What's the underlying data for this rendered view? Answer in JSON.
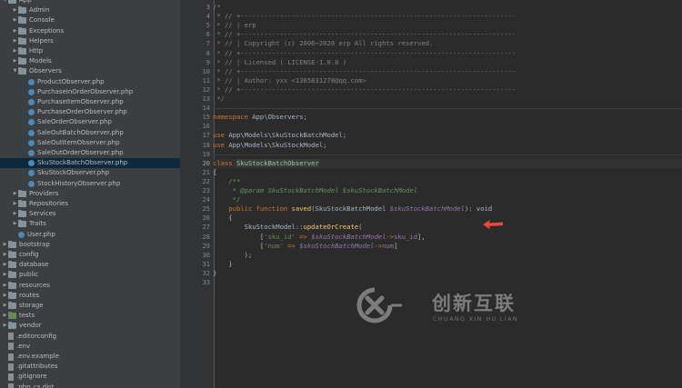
{
  "sidebar": {
    "items": [
      {
        "label": "App",
        "type": "folder",
        "depth": 0,
        "expanded": true
      },
      {
        "label": "Admin",
        "type": "folder",
        "depth": 1,
        "expanded": false
      },
      {
        "label": "Console",
        "type": "folder",
        "depth": 1,
        "expanded": false
      },
      {
        "label": "Exceptions",
        "type": "folder",
        "depth": 1,
        "expanded": false
      },
      {
        "label": "Helpers",
        "type": "folder",
        "depth": 1,
        "expanded": false
      },
      {
        "label": "Http",
        "type": "folder",
        "depth": 1,
        "expanded": false
      },
      {
        "label": "Models",
        "type": "folder",
        "depth": 1,
        "expanded": false
      },
      {
        "label": "Observers",
        "type": "folder",
        "depth": 1,
        "expanded": true
      },
      {
        "label": "ProductObserver.php",
        "type": "php",
        "depth": 2
      },
      {
        "label": "PurchaseInOrderObserver.php",
        "type": "php",
        "depth": 2
      },
      {
        "label": "PurchaseItemObserver.php",
        "type": "php",
        "depth": 2
      },
      {
        "label": "PurchaseOrderObserver.php",
        "type": "php",
        "depth": 2
      },
      {
        "label": "SaleOrderObserver.php",
        "type": "php",
        "depth": 2
      },
      {
        "label": "SaleOutBatchObserver.php",
        "type": "php",
        "depth": 2
      },
      {
        "label": "SaleOutItemObserver.php",
        "type": "php",
        "depth": 2
      },
      {
        "label": "SaleOutOrderObserver.php",
        "type": "php",
        "depth": 2
      },
      {
        "label": "SkuStockBatchObserver.php",
        "type": "php",
        "depth": 2,
        "selected": true
      },
      {
        "label": "SkuStockObserver.php",
        "type": "php",
        "depth": 2
      },
      {
        "label": "StockHistoryObserver.php",
        "type": "php",
        "depth": 2
      },
      {
        "label": "Providers",
        "type": "folder",
        "depth": 1,
        "expanded": false
      },
      {
        "label": "Repositories",
        "type": "folder",
        "depth": 1,
        "expanded": false
      },
      {
        "label": "Services",
        "type": "folder",
        "depth": 1,
        "expanded": false
      },
      {
        "label": "Traits",
        "type": "folder",
        "depth": 1,
        "expanded": false
      },
      {
        "label": "User.php",
        "type": "php",
        "depth": 1
      },
      {
        "label": "bootstrap",
        "type": "folder",
        "depth": 0,
        "expanded": false
      },
      {
        "label": "config",
        "type": "folder",
        "depth": 0,
        "expanded": false
      },
      {
        "label": "database",
        "type": "folder",
        "depth": 0,
        "expanded": false
      },
      {
        "label": "public",
        "type": "folder",
        "depth": 0,
        "expanded": false
      },
      {
        "label": "resources",
        "type": "folder",
        "depth": 0,
        "expanded": false
      },
      {
        "label": "routes",
        "type": "folder",
        "depth": 0,
        "expanded": false
      },
      {
        "label": "storage",
        "type": "folder",
        "depth": 0,
        "expanded": false
      },
      {
        "label": "tests",
        "type": "folder-green",
        "depth": 0,
        "expanded": false
      },
      {
        "label": "vendor",
        "type": "folder",
        "depth": 0,
        "expanded": false
      },
      {
        "label": ".editorconfig",
        "type": "file",
        "depth": 0
      },
      {
        "label": ".env",
        "type": "file",
        "depth": 0
      },
      {
        "label": ".env.example",
        "type": "file",
        "depth": 0
      },
      {
        "label": ".gitattributes",
        "type": "file",
        "depth": 0
      },
      {
        "label": ".gitignore",
        "type": "file",
        "depth": 0
      },
      {
        "label": ".php_cs.dist",
        "type": "file",
        "depth": 0
      }
    ]
  },
  "editor": {
    "current_line": 20,
    "lines": [
      {
        "no": "3",
        "t": [
          [
            "cm",
            "/*"
          ]
        ]
      },
      {
        "no": "4",
        "t": [
          [
            "cm",
            " * // +----------------------------------------------------------------------"
          ]
        ]
      },
      {
        "no": "5",
        "t": [
          [
            "cm",
            " * // | erp"
          ]
        ]
      },
      {
        "no": "6",
        "t": [
          [
            "cm",
            " * // +----------------------------------------------------------------------"
          ]
        ]
      },
      {
        "no": "7",
        "t": [
          [
            "cm",
            " * // | Copyright (c) 2006~2020 erp All rights reserved."
          ]
        ]
      },
      {
        "no": "8",
        "t": [
          [
            "cm",
            " * // +----------------------------------------------------------------------"
          ]
        ]
      },
      {
        "no": "9",
        "t": [
          [
            "cm",
            " * // | Licensed ( LICENSE-1.0.0 )"
          ]
        ]
      },
      {
        "no": "10",
        "t": [
          [
            "cm",
            " * // +----------------------------------------------------------------------"
          ]
        ]
      },
      {
        "no": "11",
        "t": [
          [
            "cm",
            " * // | Author: yxx <1365831278@qq.com>"
          ]
        ]
      },
      {
        "no": "12",
        "t": [
          [
            "cm",
            " * // +----------------------------------------------------------------------"
          ]
        ]
      },
      {
        "no": "13",
        "t": [
          [
            "cm",
            " */"
          ]
        ]
      },
      {
        "no": "14",
        "t": []
      },
      {
        "no": "15",
        "t": [
          [
            "kw",
            "namespace "
          ],
          [
            "",
            "App\\Observers;"
          ]
        ]
      },
      {
        "no": "16",
        "t": []
      },
      {
        "no": "17",
        "t": [
          [
            "kw",
            "use "
          ],
          [
            "",
            "App\\Models\\SkuStockBatchModel;"
          ]
        ]
      },
      {
        "no": "18",
        "t": [
          [
            "kw",
            "use "
          ],
          [
            "",
            "App\\Models\\SkuStockModel;"
          ]
        ]
      },
      {
        "no": "19",
        "t": []
      },
      {
        "no": "20",
        "t": [
          [
            "kw",
            "class "
          ],
          [
            "hl",
            "SkuStockBatchObserver"
          ]
        ]
      },
      {
        "no": "21",
        "t": [
          [
            "",
            "{"
          ]
        ]
      },
      {
        "no": "22",
        "t": [
          [
            "doc",
            "    /**"
          ]
        ]
      },
      {
        "no": "23",
        "t": [
          [
            "doc",
            "     * @param SkuStockBatchModel $skuStockBatchModel"
          ]
        ]
      },
      {
        "no": "24",
        "t": [
          [
            "doc",
            "     */"
          ]
        ]
      },
      {
        "no": "25",
        "t": [
          [
            "kw",
            "    public function "
          ],
          [
            "fn",
            "saved"
          ],
          [
            "",
            "(SkuStockBatchModel "
          ],
          [
            "var",
            "$skuStockBatchModel"
          ],
          [
            "",
            "): void"
          ]
        ]
      },
      {
        "no": "26",
        "t": [
          [
            "",
            "    {"
          ]
        ]
      },
      {
        "no": "27",
        "t": [
          [
            "",
            "        SkuStockModel::"
          ],
          [
            "stat",
            "updateOrCreate"
          ],
          [
            "",
            "("
          ]
        ]
      },
      {
        "no": "28",
        "t": [
          [
            "",
            "            ["
          ],
          [
            "str",
            "'sku_id'"
          ],
          [
            "kw",
            " => "
          ],
          [
            "var",
            "$skuStockBatchModel"
          ],
          [
            "kw",
            "->"
          ],
          [
            "prop",
            "sku_id"
          ],
          [
            "",
            "],"
          ]
        ]
      },
      {
        "no": "29",
        "t": [
          [
            "",
            "            ["
          ],
          [
            "str",
            "'num'"
          ],
          [
            "kw",
            " => "
          ],
          [
            "var",
            "$skuStockBatchModel"
          ],
          [
            "kw",
            "->"
          ],
          [
            "prop",
            "num"
          ],
          [
            "",
            "]"
          ]
        ]
      },
      {
        "no": "30",
        "t": [
          [
            "",
            "        );"
          ]
        ]
      },
      {
        "no": "31",
        "t": [
          [
            "",
            "    }"
          ]
        ]
      },
      {
        "no": "32",
        "t": [
          [
            "",
            "}"
          ]
        ]
      },
      {
        "no": "33",
        "t": []
      }
    ]
  },
  "annotation": {
    "arrow_color": "#e84a3b"
  },
  "watermark": {
    "brand_cn": "创新互联",
    "brand_en": "CHUANG XIN HU LIAN"
  }
}
